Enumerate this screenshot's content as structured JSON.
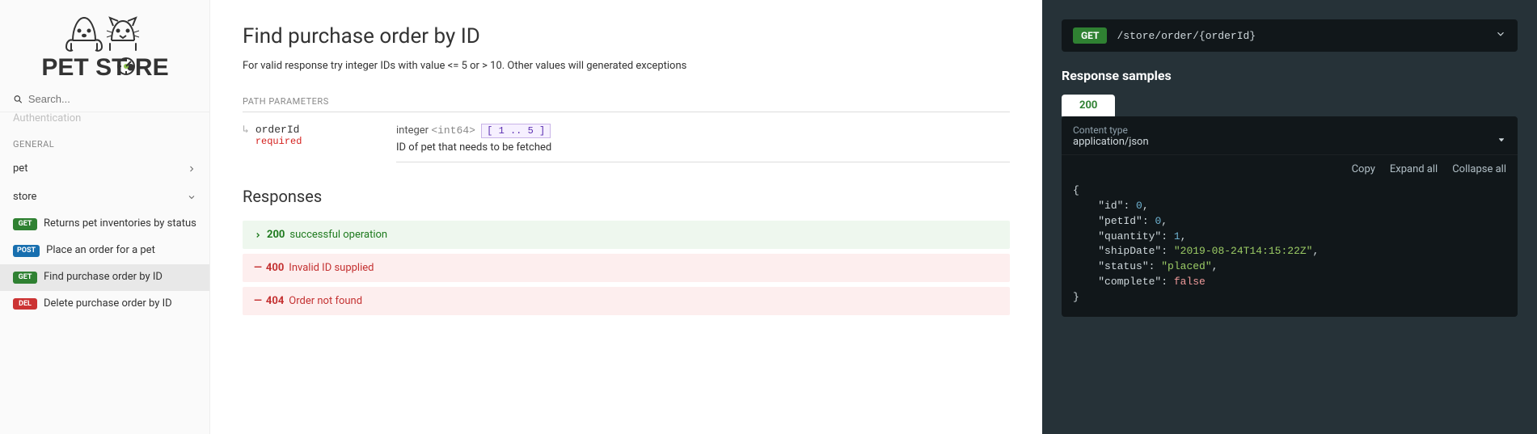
{
  "sidebar": {
    "search_placeholder": "Search...",
    "truncated_item": "Authentication",
    "section_label": "GENERAL",
    "items": [
      {
        "label": "pet"
      },
      {
        "label": "store"
      }
    ],
    "ops": [
      {
        "method": "GET",
        "label": "Returns pet inventories by status"
      },
      {
        "method": "POST",
        "label": "Place an order for a pet"
      },
      {
        "method": "GET",
        "label": "Find purchase order by ID"
      },
      {
        "method": "DEL",
        "label": "Delete purchase order by ID"
      }
    ]
  },
  "center": {
    "title": "Find purchase order by ID",
    "description": "For valid response try integer IDs with value <= 5 or > 10. Other values will generated exceptions",
    "path_params_label": "PATH PARAMETERS",
    "param": {
      "name": "orderId",
      "required_label": "required",
      "type_prefix": "integer",
      "type_format": "<int64>",
      "range": "[ 1 .. 5 ]",
      "description": "ID of pet that needs to be fetched"
    },
    "responses_title": "Responses",
    "responses": [
      {
        "code": "200",
        "text": "successful operation"
      },
      {
        "code": "400",
        "text": "Invalid ID supplied"
      },
      {
        "code": "404",
        "text": "Order not found"
      }
    ]
  },
  "right": {
    "method": "GET",
    "path": "/store/order/{orderId}",
    "response_samples_title": "Response samples",
    "tab": "200",
    "content_type_label": "Content type",
    "content_type_value": "application/json",
    "actions": {
      "copy": "Copy",
      "expand": "Expand all",
      "collapse": "Collapse all"
    },
    "sample": {
      "id": 0,
      "petId": 0,
      "quantity": 1,
      "shipDate": "2019-08-24T14:15:22Z",
      "status": "placed",
      "complete": false
    }
  }
}
